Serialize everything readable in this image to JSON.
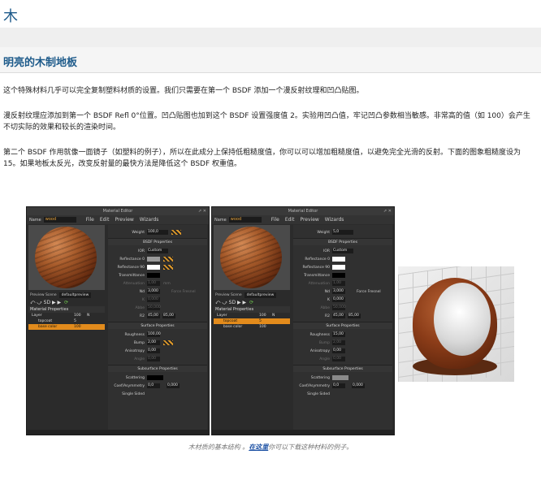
{
  "page": {
    "title": "木",
    "section_heading": "明亮的木制地板",
    "paragraphs": [
      "这个特殊材料几乎可以完全复制塑料材质的设置。我们只需要在第一个 BSDF 添加一个漫反射纹理和凹凸贴图。",
      "漫反射纹理应添加到第一个 BSDF Refl 0°位置。凹凸贴图也加到这个 BSDF 设置强度值 2。实验用凹凸值，牢记凹凸参数相当敏感。非常高的值（如 100）会产生不切实际的效果和较长的渲染时间。",
      "第二个 BSDF 作用就像一面镜子（如塑料的例子），所以在此成分上保持低粗糙度值，你可以可以增加粗糙度值，以避免完全光滑的反射。下面的图象粗糙度设为 15。如果地板太反光，改变反射量的最快方法是降低这个 BSDF 权重值。"
    ],
    "caption_before": "木材质的基本结构 。",
    "caption_link": "在这里",
    "caption_after": "你可以下载这种材料的例子。"
  },
  "editor_left": {
    "window_title": "Material Editor",
    "window_buttons": "⇗ ✕",
    "name_label": "Name",
    "name_value": "wood",
    "menu": [
      "File",
      "Edit",
      "Preview",
      "Wizards"
    ],
    "preview_label": "Preview Scene",
    "preview_value": "defaultpreview",
    "tool_icons": "⤺ ⤻ SD ▶ ▶",
    "material_properties": "Material Properties",
    "layers": [
      {
        "name": "Layer",
        "value": "100",
        "mode": "N"
      },
      {
        "name": "topcoat",
        "value": "5",
        "mode": ""
      },
      {
        "name": "base color",
        "value": "100",
        "mode": ""
      }
    ],
    "weight_label": "Weight",
    "weight_value": "100,0",
    "bsdf_header": "BSDF Properties",
    "ior_label": "IOR",
    "ior_value": "Custom",
    "refl0_label": "Reflectance 0",
    "refl90_label": "Reflectance 90",
    "transmittance_label": "Transmittance",
    "attenuation_label": "Attenuation",
    "attenuation_value": "1,00",
    "attenuation_unit": "mm",
    "nd_label": "Nd",
    "nd_value": "3,000",
    "force_fresnel_label": "Force Fresnel",
    "k_label": "K",
    "k_value": "0,000",
    "abbe_label": "Abbe",
    "abbe_value": "50,000",
    "r2_label": "R2",
    "r2_value_a": "45,00",
    "r2_value_b": "85,00",
    "surface_header": "Surface Properties",
    "roughness_label": "Roughness",
    "roughness_value": "100,00",
    "bump_label": "Bump",
    "bump_value": "2,00",
    "anisotropy_label": "Anisotropy",
    "anisotropy_value": "0,00",
    "angle_label": "Angle",
    "angle_value": "0,00",
    "subsurface_header": "Subsurface Properties",
    "scattering_label": "Scattering",
    "coef_label": "Coef/Asymmetry",
    "coef_value_a": "0,0",
    "coef_value_b": "0,000",
    "single_sided_label": "Single Sided"
  },
  "editor_right": {
    "window_title": "Material Editor",
    "name_value": "wood",
    "weight_value": "5,0",
    "nd_value": "3,000",
    "k_value": "0,000",
    "roughness_value": "15,00",
    "bump_value": "2,00",
    "anisotropy_value": "0,00",
    "coef_value_a": "0,0",
    "coef_value_b": "0,000"
  },
  "colors": {
    "title_blue": "#1d5a8a",
    "link_blue": "#1a4fa3",
    "highlight_orange": "#e28b1c"
  }
}
